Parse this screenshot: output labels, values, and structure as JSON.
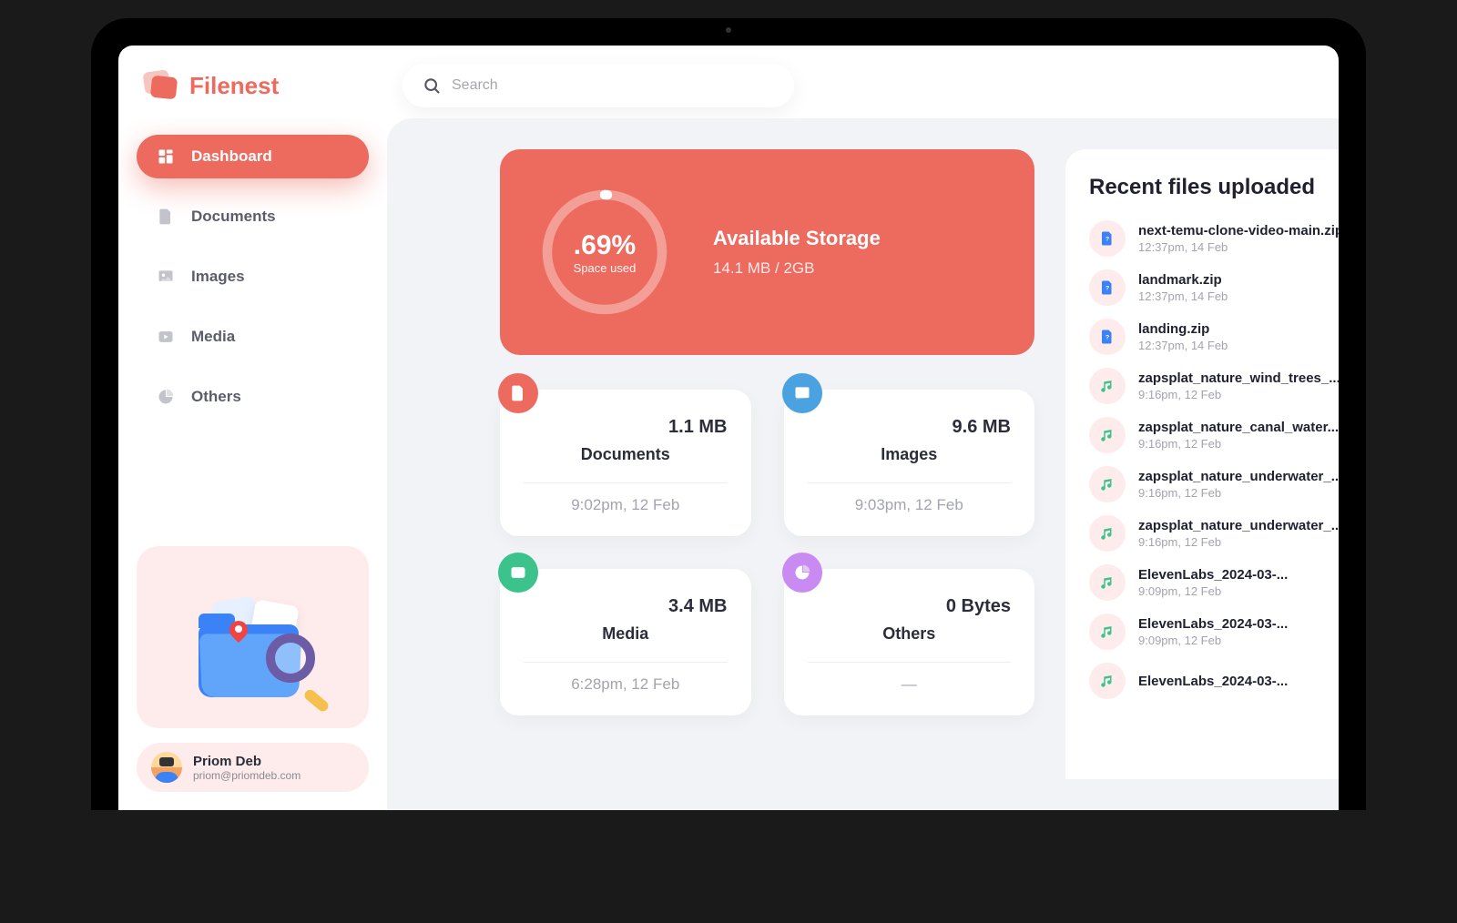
{
  "app": {
    "name": "Filenest"
  },
  "search": {
    "placeholder": "Search"
  },
  "sidebar": {
    "items": [
      {
        "label": "Dashboard",
        "icon": "dashboard-icon",
        "active": true
      },
      {
        "label": "Documents",
        "icon": "documents-icon",
        "active": false
      },
      {
        "label": "Images",
        "icon": "images-icon",
        "active": false
      },
      {
        "label": "Media",
        "icon": "media-icon",
        "active": false
      },
      {
        "label": "Others",
        "icon": "others-icon",
        "active": false
      }
    ]
  },
  "user": {
    "name": "Priom Deb",
    "email": "priom@priomdeb.com"
  },
  "storage": {
    "percent_label": ".69%",
    "percent_value": 0.69,
    "space_used_label": "Space used",
    "title": "Available Storage",
    "subtitle": "14.1 MB / 2GB"
  },
  "categories": [
    {
      "key": "documents",
      "name": "Documents",
      "size": "1.1 MB",
      "time": "9:02pm, 12 Feb",
      "iconClass": "cat-docs"
    },
    {
      "key": "images",
      "name": "Images",
      "size": "9.6 MB",
      "time": "9:03pm, 12 Feb",
      "iconClass": "cat-imgs"
    },
    {
      "key": "media",
      "name": "Media",
      "size": "3.4 MB",
      "time": "6:28pm, 12 Feb",
      "iconClass": "cat-media"
    },
    {
      "key": "others",
      "name": "Others",
      "size": "0 Bytes",
      "time": "—",
      "iconClass": "cat-others"
    }
  ],
  "recent": {
    "title": "Recent files uploaded",
    "items": [
      {
        "name": "next-temu-clone-video-main.zip",
        "time": "12:37pm, 14 Feb",
        "type": "file"
      },
      {
        "name": "landmark.zip",
        "time": "12:37pm, 14 Feb",
        "type": "file"
      },
      {
        "name": "landing.zip",
        "time": "12:37pm, 14 Feb",
        "type": "file"
      },
      {
        "name": "zapsplat_nature_wind_trees_...",
        "time": "9:16pm, 12 Feb",
        "type": "audio"
      },
      {
        "name": "zapsplat_nature_canal_water...",
        "time": "9:16pm, 12 Feb",
        "type": "audio"
      },
      {
        "name": "zapsplat_nature_underwater_...",
        "time": "9:16pm, 12 Feb",
        "type": "audio"
      },
      {
        "name": "zapsplat_nature_underwater_...",
        "time": "9:16pm, 12 Feb",
        "type": "audio"
      },
      {
        "name": "ElevenLabs_2024-03-...",
        "time": "9:09pm, 12 Feb",
        "type": "audio"
      },
      {
        "name": "ElevenLabs_2024-03-...",
        "time": "9:09pm, 12 Feb",
        "type": "audio"
      },
      {
        "name": "ElevenLabs_2024-03-...",
        "time": "",
        "type": "audio"
      }
    ]
  }
}
